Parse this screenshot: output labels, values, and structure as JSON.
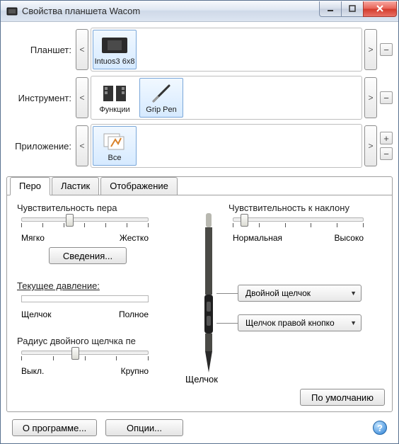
{
  "window": {
    "title": "Свойства планшета Wacom"
  },
  "selectors": {
    "tablet_label": "Планшет:",
    "tool_label": "Инструмент:",
    "app_label": "Приложение:",
    "tablet_item": "Intuos3 6x8",
    "tool_item1": "Функции",
    "tool_item2": "Grip Pen",
    "app_item": "Все",
    "nav_prev": "<",
    "nav_next": ">",
    "plus": "+",
    "minus": "−"
  },
  "tabs": {
    "pen": "Перо",
    "eraser": "Ластик",
    "mapping": "Отображение"
  },
  "pen_tab": {
    "tip_sensitivity_title": "Чувствительность пера",
    "tip_soft": "Мягко",
    "tip_firm": "Жестко",
    "details_btn": "Сведения...",
    "current_pressure_title": "Текущее давление:",
    "pressure_click": "Щелчок",
    "pressure_full": "Полное",
    "dbl_click_title": "Радиус двойного щелчка пе",
    "dbl_off": "Выкл.",
    "dbl_large": "Крупно",
    "click_label": "Щелчок",
    "tilt_title": "Чувствительность к наклону",
    "tilt_normal": "Нормальная",
    "tilt_high": "Высоко",
    "dropdown1": "Двойной щелчок",
    "dropdown2": "Щелчок правой кнопко",
    "default_btn": "По умолчанию"
  },
  "footer": {
    "about": "О программе...",
    "options": "Опции...",
    "help": "?"
  }
}
